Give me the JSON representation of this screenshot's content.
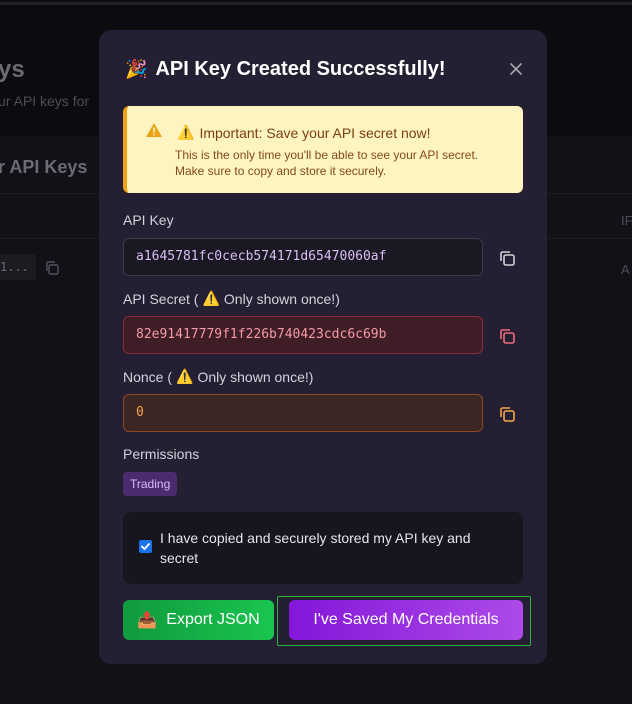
{
  "background": {
    "title": "ys",
    "subtitle": "ur API keys for",
    "panel_title": "r API Keys",
    "header_right": "IF",
    "row_key_preview": "1...",
    "row_right": "A"
  },
  "modal": {
    "icon": "party-popper-icon",
    "title": "API Key Created Successfully!",
    "alert": {
      "title": "Important: Save your API secret now!",
      "body_line1": "This is the only time you'll be able to see your API secret.",
      "body_line2": "Make sure to copy and store it securely."
    },
    "fields": {
      "api_key_label": "API Key",
      "api_key_value": "a1645781fc0cecb574171d65470060af",
      "api_secret_label": "API Secret (",
      "api_secret_note": "Only shown once!)",
      "api_secret_value": "82e91417779f1f226b740423cdc6c69b",
      "nonce_label": "Nonce (",
      "nonce_note": "Only shown once!)",
      "nonce_value": "0"
    },
    "permissions": {
      "label": "Permissions",
      "items": [
        "Trading"
      ]
    },
    "confirmation": {
      "checked": true,
      "text": "I have copied and securely stored my API key and secret"
    },
    "buttons": {
      "export_label": "Export JSON",
      "saved_label": "I've Saved My Credentials"
    }
  },
  "colors": {
    "modal_bg": "#241f32",
    "alert_bg": "#fef4c2",
    "secret_border": "#8a2d3b",
    "nonce_border": "#8b4a26",
    "export_green": "#19c54f",
    "saved_purple": "#9c2fe1"
  }
}
